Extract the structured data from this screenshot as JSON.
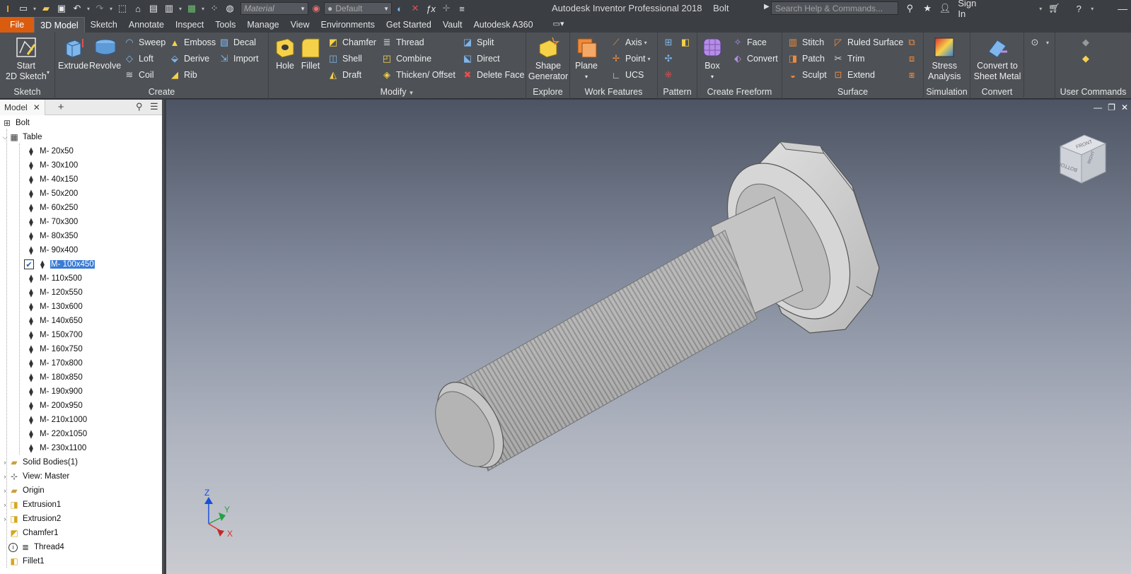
{
  "title": {
    "app_name": "Autodesk Inventor Professional 2018",
    "document": "Bolt",
    "material_placeholder": "Material",
    "appearance_value": "Default",
    "search_placeholder": "Search Help & Commands...",
    "sign_in": "Sign In"
  },
  "tabs": [
    "File",
    "3D Model",
    "Sketch",
    "Annotate",
    "Inspect",
    "Tools",
    "Manage",
    "View",
    "Environments",
    "Get Started",
    "Vault",
    "Autodesk A360"
  ],
  "active_tab": "3D Model",
  "ribbon": {
    "sketch": {
      "title": "Sketch",
      "start": "Start",
      "start2": "2D Sketch"
    },
    "create": {
      "title": "Create",
      "extrude": "Extrude",
      "revolve": "Revolve",
      "sweep": "Sweep",
      "loft": "Loft",
      "coil": "Coil",
      "emboss": "Emboss",
      "derive": "Derive",
      "rib": "Rib",
      "decal": "Decal",
      "import": "Import"
    },
    "modify": {
      "title": "Modify",
      "hole": "Hole",
      "fillet": "Fillet",
      "chamfer": "Chamfer",
      "shell": "Shell",
      "draft": "Draft",
      "thread": "Thread",
      "combine": "Combine",
      "thicken": "Thicken/ Offset",
      "split": "Split",
      "direct": "Direct",
      "delete_face": "Delete Face"
    },
    "explore": {
      "title": "Explore",
      "shape1": "Shape",
      "shape2": "Generator"
    },
    "work": {
      "title": "Work Features",
      "plane": "Plane",
      "axis": "Axis",
      "point": "Point",
      "ucs": "UCS"
    },
    "pattern": {
      "title": "Pattern"
    },
    "freeform": {
      "title": "Create Freeform",
      "box": "Box",
      "face": "Face",
      "convert": "Convert"
    },
    "surface": {
      "title": "Surface",
      "stitch": "Stitch",
      "patch": "Patch",
      "sculpt": "Sculpt",
      "ruled": "Ruled Surface",
      "trim": "Trim",
      "extend": "Extend"
    },
    "simulation": {
      "title": "Simulation",
      "stress1": "Stress",
      "stress2": "Analysis"
    },
    "convert": {
      "title": "Convert",
      "c1": "Convert to",
      "c2": "Sheet Metal"
    },
    "user": {
      "title": "User Commands"
    }
  },
  "browser": {
    "tab": "Model",
    "root": "Bolt",
    "table": "Table",
    "members": [
      "M- 20x50",
      "M- 30x100",
      "M- 40x150",
      "M- 50x200",
      "M- 60x250",
      "M- 70x300",
      "M- 80x350",
      "M- 90x400",
      "M- 100x450",
      "M- 110x500",
      "M- 120x550",
      "M- 130x600",
      "M- 140x650",
      "M- 150x700",
      "M- 160x750",
      "M- 170x800",
      "M- 180x850",
      "M- 190x900",
      "M- 200x950",
      "M- 210x1000",
      "M- 220x1050",
      "M- 230x1100"
    ],
    "selected_member": "M- 100x450",
    "features": [
      "Solid Bodies(1)",
      "View: Master",
      "Origin",
      "Extrusion1",
      "Extrusion2",
      "Chamfer1",
      "Thread4",
      "Fillet1"
    ]
  },
  "viewcube": {
    "front": "FRONT",
    "bottom": "BOTTOM",
    "right": "RIGHT"
  },
  "triad": {
    "x": "X",
    "y": "Y",
    "z": "Z"
  },
  "colors": {
    "file_tab": "#d95c0f",
    "selection": "#3a7bd5",
    "axis_x": "#e03030",
    "axis_y": "#22a344",
    "axis_z": "#1a50d8"
  }
}
